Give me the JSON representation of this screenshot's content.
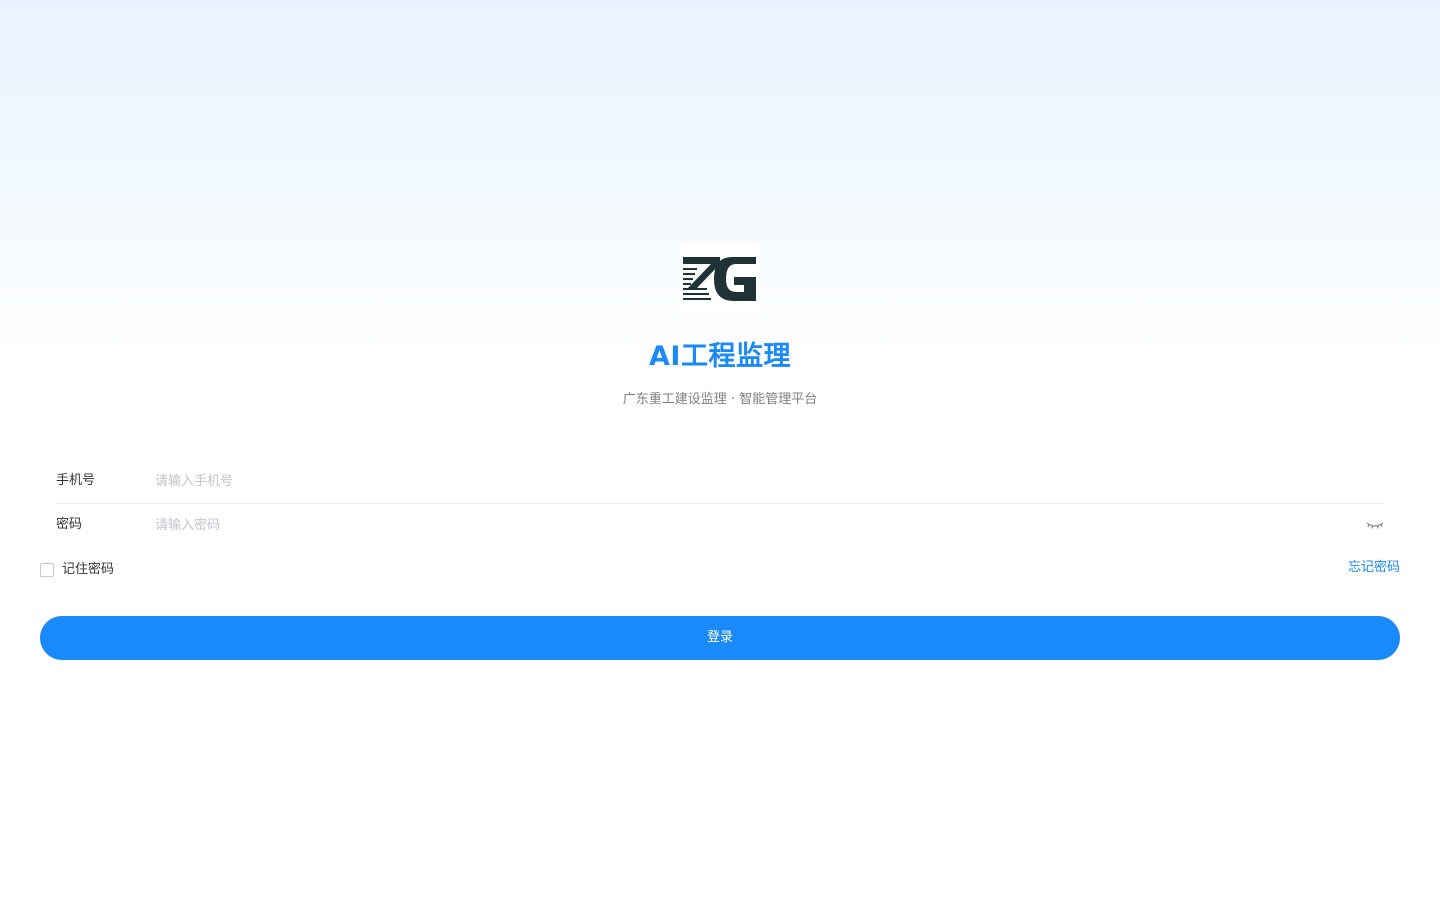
{
  "brand": {
    "logo_text": "ZG",
    "title": "AI工程监理",
    "subtitle": "广东重工建设监理 · 智能管理平台",
    "accent_color": "#1a89fa"
  },
  "form": {
    "phone": {
      "label": "手机号",
      "placeholder": "请输入手机号",
      "value": ""
    },
    "password": {
      "label": "密码",
      "placeholder": "请输入密码",
      "value": "",
      "toggle_icon": "eye-closed-icon"
    },
    "remember": {
      "label": "记住密码",
      "checked": false
    },
    "forgot_label": "忘记密码",
    "submit_label": "登录"
  }
}
